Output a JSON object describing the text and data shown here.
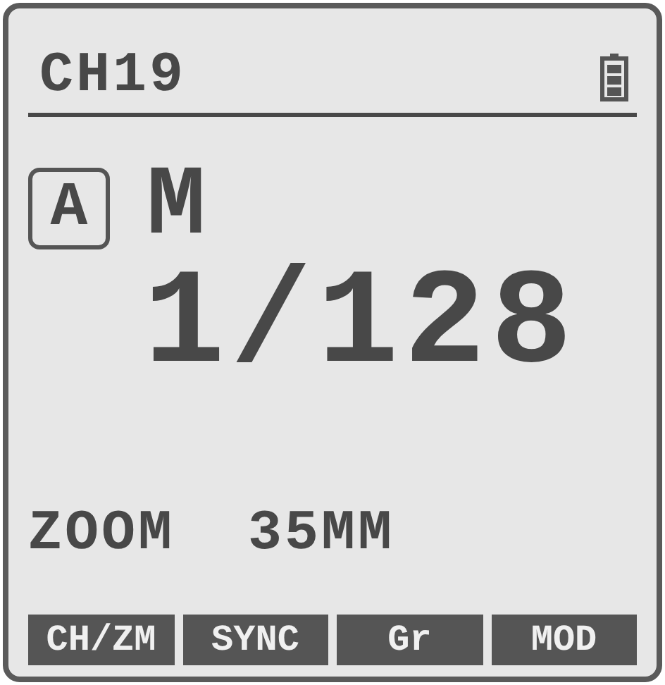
{
  "header": {
    "channel": "CH19"
  },
  "mode": {
    "group": "A",
    "flash_mode": "M"
  },
  "power": "1/128",
  "zoom": "ZOOM  35MM",
  "softkeys": [
    "CH/ZM",
    "SYNC",
    "Gr",
    "MOD"
  ]
}
